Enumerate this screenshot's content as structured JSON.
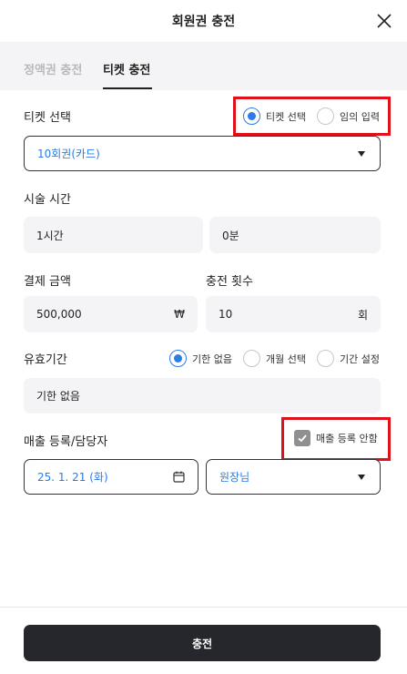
{
  "header": {
    "title": "회원권 충전",
    "close_icon": "close-icon"
  },
  "tabs": [
    {
      "label": "정액권 충전",
      "active": false
    },
    {
      "label": "티켓 충전",
      "active": true
    }
  ],
  "ticket_select": {
    "label": "티켓 선택",
    "options": [
      {
        "label": "티켓 선택",
        "checked": true
      },
      {
        "label": "임의 입력",
        "checked": false
      }
    ],
    "dropdown_value": "10회권(카드)"
  },
  "treatment_time": {
    "label": "시술 시간",
    "hours": "1시간",
    "minutes": "0분"
  },
  "payment": {
    "label": "결제 금액",
    "value": "500,000",
    "unit": "₩"
  },
  "charge_count": {
    "label": "충전 횟수",
    "value": "10",
    "unit": "회"
  },
  "validity": {
    "label": "유효기간",
    "options": [
      {
        "label": "기한 없음",
        "checked": true
      },
      {
        "label": "개월 선택",
        "checked": false
      },
      {
        "label": "기간 설정",
        "checked": false
      }
    ],
    "value": "기한 없음"
  },
  "sales": {
    "label": "매출 등록/담당자",
    "no_register_label": "매출 등록 안함",
    "no_register_checked": true,
    "date": "25. 1. 21 (화)",
    "staff": "원장님"
  },
  "submit_label": "충전",
  "colors": {
    "accent": "#2d7be5",
    "primary_button": "#25272c",
    "highlight": "#e0111b",
    "field_bg": "#f4f4f6"
  }
}
